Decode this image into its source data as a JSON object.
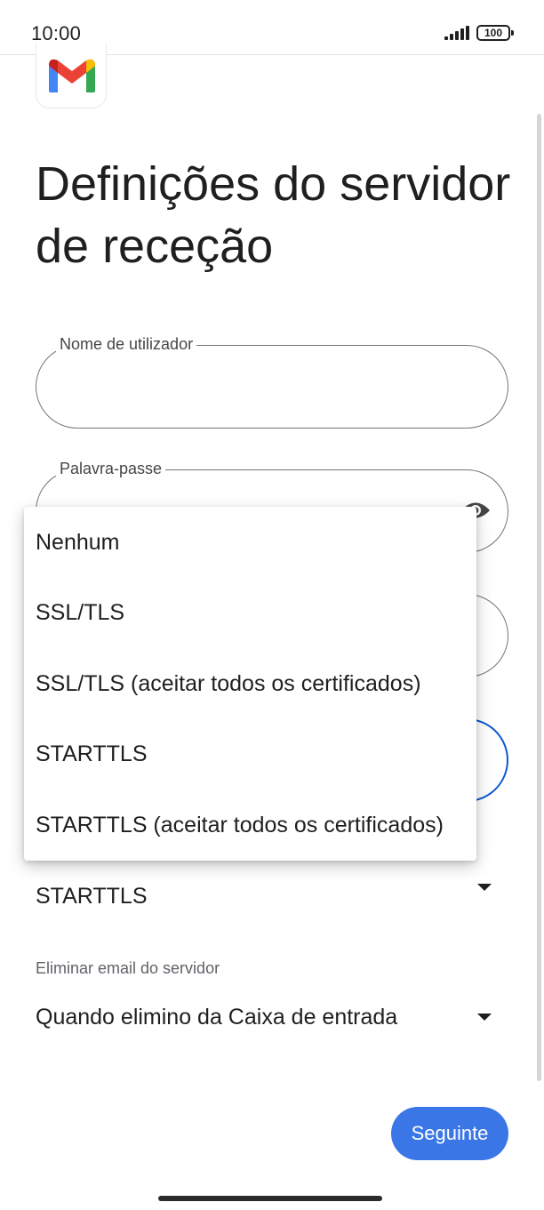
{
  "status_bar": {
    "time": "10:00",
    "battery": "100",
    "icons": [
      "signal-icon",
      "battery-icon"
    ]
  },
  "app": {
    "logo_icon": "gmail-logo-icon",
    "brand_colors": {
      "blue": "#4285F4",
      "red": "#EA4335",
      "yellow": "#FBBC04",
      "green": "#34A853"
    }
  },
  "page": {
    "title": "Definições do servidor de receção"
  },
  "form": {
    "username": {
      "label": "Nome de utilizador",
      "value": ""
    },
    "password": {
      "label": "Palavra-passe",
      "value": "",
      "toggle_icon": "eye-icon"
    },
    "security_type": {
      "selected": "STARTTLS",
      "caret_icon": "dropdown-arrow-icon"
    },
    "delete_email": {
      "label": "Eliminar email do servidor",
      "selected": "Quando elimino da Caixa de entrada",
      "caret_icon": "dropdown-arrow-icon"
    }
  },
  "security_menu": {
    "options": [
      "Nenhum",
      "SSL/TLS",
      "SSL/TLS (aceitar todos os certificados)",
      "STARTTLS",
      "STARTTLS (aceitar todos os certificados)"
    ]
  },
  "actions": {
    "next_label": "Seguinte",
    "accent_color": "#3a76e6"
  }
}
